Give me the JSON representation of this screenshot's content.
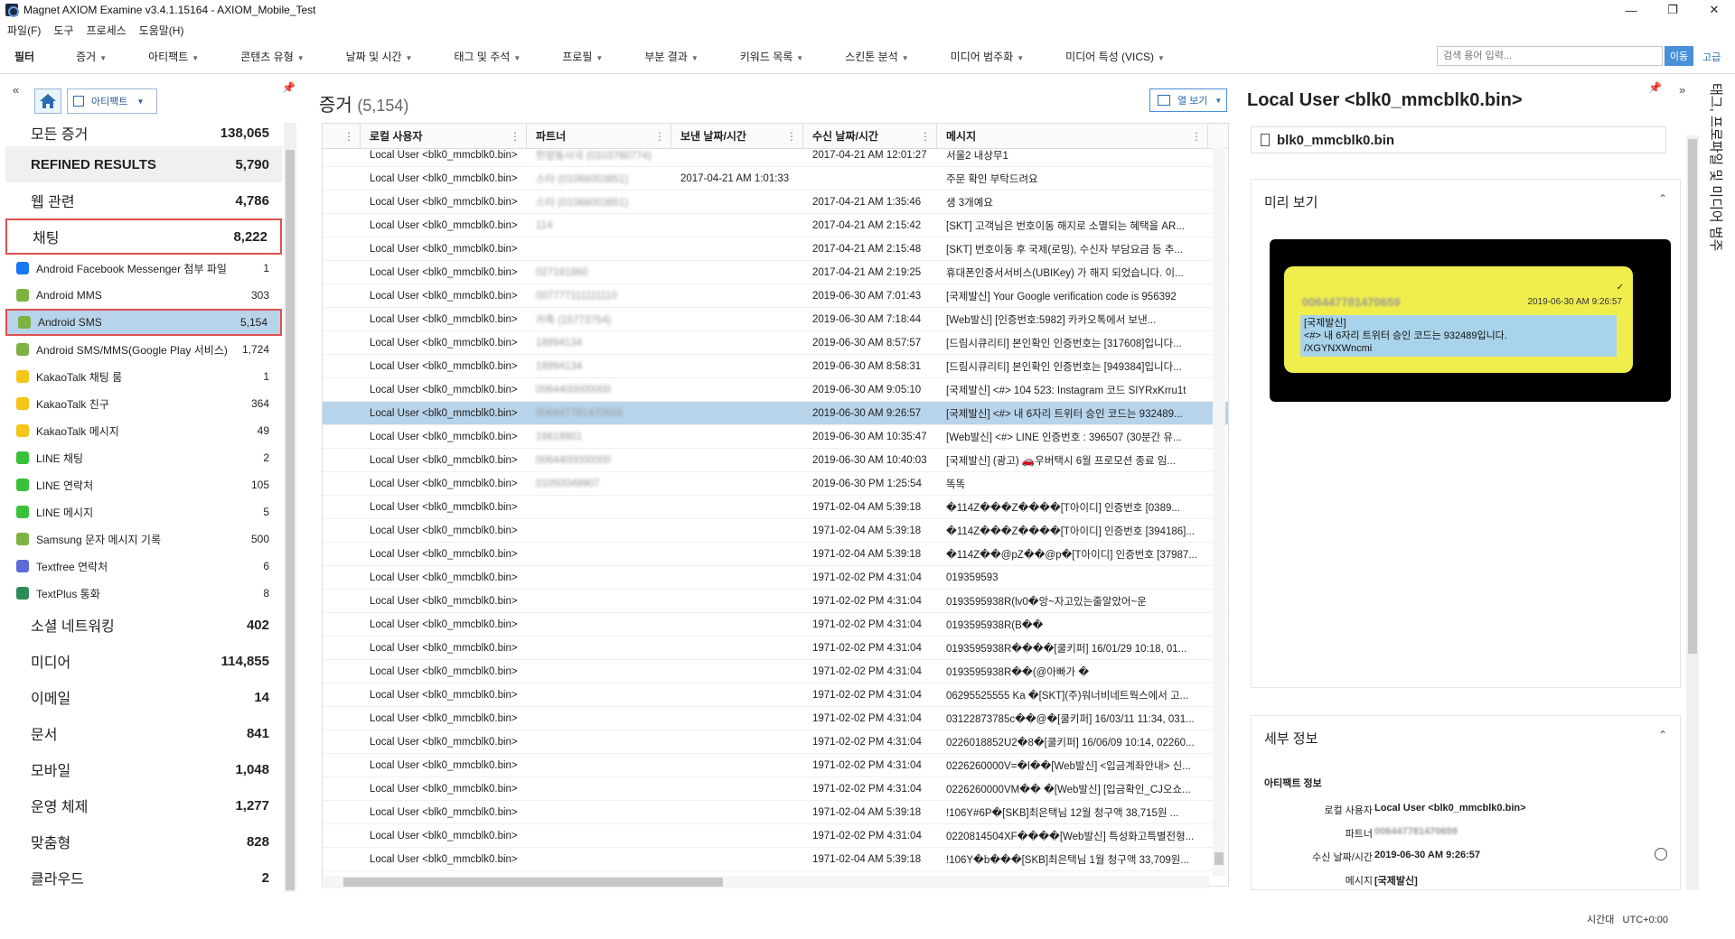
{
  "window": {
    "title": "Magnet AXIOM Examine v3.4.1.15164 - AXIOM_Mobile_Test"
  },
  "menu": [
    "파일(F)",
    "도구",
    "프로세스",
    "도움말(H)"
  ],
  "toolbar": {
    "filter": "필터",
    "items": [
      "증거",
      "아티팩트",
      "콘텐츠 유형",
      "날짜 및 시간",
      "태그 및 주석",
      "프로필",
      "부분 결과",
      "키워드 목록",
      "스킨톤 분석",
      "미디어 범주화",
      "미디어 특성 (VICS)"
    ],
    "search_placeholder": "검색 용어 입력...",
    "search_go": "이동",
    "advanced": "고급"
  },
  "left": {
    "artifact_btn": "아티팩트",
    "categories_top": [
      {
        "label": "모든 증거",
        "count": "138,065"
      },
      {
        "label": "REFINED RESULTS",
        "count": "5,790"
      },
      {
        "label": "웹 관련",
        "count": "4,786"
      },
      {
        "label": "채팅",
        "count": "8,222"
      }
    ],
    "chat_items": [
      {
        "label": "Android Facebook Messenger 첨부 파일",
        "count": "1",
        "color": "#1877f2"
      },
      {
        "label": "Android MMS",
        "count": "303",
        "color": "#7cb342"
      },
      {
        "label": "Android SMS",
        "count": "5,154",
        "color": "#7cb342"
      },
      {
        "label": "Android SMS/MMS(Google Play 서비스)",
        "count": "1,724",
        "color": "#7cb342"
      },
      {
        "label": "KakaoTalk 채팅 룸",
        "count": "1",
        "color": "#f5c518"
      },
      {
        "label": "KakaoTalk 친구",
        "count": "364",
        "color": "#f5c518"
      },
      {
        "label": "KakaoTalk 메시지",
        "count": "49",
        "color": "#f5c518"
      },
      {
        "label": "LINE 채팅",
        "count": "2",
        "color": "#3ac13a"
      },
      {
        "label": "LINE 연락처",
        "count": "105",
        "color": "#3ac13a"
      },
      {
        "label": "LINE 메시지",
        "count": "5",
        "color": "#3ac13a"
      },
      {
        "label": "Samsung 문자 메시지 기록",
        "count": "500",
        "color": "#7cb342"
      },
      {
        "label": "Textfree 연락처",
        "count": "6",
        "color": "#5b6bd8"
      },
      {
        "label": "TextPlus 통화",
        "count": "8",
        "color": "#2e8b57"
      }
    ],
    "categories_bottom": [
      {
        "label": "소셜 네트워킹",
        "count": "402"
      },
      {
        "label": "미디어",
        "count": "114,855"
      },
      {
        "label": "이메일",
        "count": "14"
      },
      {
        "label": "문서",
        "count": "841"
      },
      {
        "label": "모바일",
        "count": "1,048"
      },
      {
        "label": "운영 체제",
        "count": "1,277"
      },
      {
        "label": "맞춤형",
        "count": "828"
      },
      {
        "label": "클라우드",
        "count": "2"
      }
    ]
  },
  "middle": {
    "title": "증거",
    "count": "(5,154)",
    "column_view": "열 보기",
    "columns": [
      "로컬 사용자",
      "파트너",
      "보낸 날짜/시간",
      "수신 날짜/시간",
      "메시지"
    ],
    "rows": [
      [
        "Local User <blk0_mmcblk0.bin>",
        "한양동사국 (0103780774)",
        "",
        "2017-04-21 AM 12:01:27",
        "서울2 내상무1"
      ],
      [
        "Local User <blk0_mmcblk0.bin>",
        "스타 (01066003851)",
        "2017-04-21 AM 1:01:33",
        "",
        "주문 확인 부탁드려요"
      ],
      [
        "Local User <blk0_mmcblk0.bin>",
        "스타 (01066003851)",
        "",
        "2017-04-21 AM 1:35:46",
        "생 3개예요"
      ],
      [
        "Local User <blk0_mmcblk0.bin>",
        "114",
        "",
        "2017-04-21 AM 2:15:42",
        "[SKT] 고객님은 번호이동 해지로 소멸되는 혜택을 AR..."
      ],
      [
        "Local User <blk0_mmcblk0.bin>",
        "",
        "",
        "2017-04-21 AM 2:15:48",
        "[SKT] 번호이동 후 국제(로밍), 수신자 부담요금 등 추..."
      ],
      [
        "Local User <blk0_mmcblk0.bin>",
        "027181860",
        "",
        "2017-04-21 AM 2:19:25",
        "휴대폰인증서서비스(UBIKey) 가 해지 되었습니다. 이..."
      ],
      [
        "Local User <blk0_mmcblk0.bin>",
        "007777111111110",
        "",
        "2019-06-30 AM 7:01:43",
        "[국제발신] Your Google verification code is 956392"
      ],
      [
        "Local User <blk0_mmcblk0.bin>",
        "카톡 (15773754)",
        "",
        "2019-06-30 AM 7:18:44",
        "[Web발신] [인증번호:5982] 카카오톡에서 보낸..."
      ],
      [
        "Local User <blk0_mmcblk0.bin>",
        "18994134",
        "",
        "2019-06-30 AM 8:57:57",
        "[드림시큐리티] 본인확인 인증번호는 [317608]입니다..."
      ],
      [
        "Local User <blk0_mmcblk0.bin>",
        "18994134",
        "",
        "2019-06-30 AM 8:58:31",
        "[드림시큐리티] 본인확인 인증번호는 [949384]입니다..."
      ],
      [
        "Local User <blk0_mmcblk0.bin>",
        "0064400000000",
        "",
        "2019-06-30 AM 9:05:10",
        "[국제발신] <#> 104 523: Instagram 코드 SIYRxKrru1t"
      ],
      [
        "Local User <blk0_mmcblk0.bin>",
        "006447781470659",
        "",
        "2019-06-30 AM 9:26:57",
        "[국제발신] <#> 내 6자리 트위터 승인 코드는 932489..."
      ],
      [
        "Local User <blk0_mmcblk0.bin>",
        "16618901",
        "",
        "2019-06-30 AM 10:35:47",
        "[Web발신] <#> LINE 인증번호 : 396507 (30분간 유..."
      ],
      [
        "Local User <blk0_mmcblk0.bin>",
        "0064400000000",
        "",
        "2019-06-30 AM 10:40:03",
        "[국제발신] (광고) 🚗우버택시 6월 프로모션 종료 임..."
      ],
      [
        "Local User <blk0_mmcblk0.bin>",
        "01050049907",
        "",
        "2019-06-30 PM 1:25:54",
        "똑똑"
      ],
      [
        "Local User <blk0_mmcblk0.bin>",
        "",
        "",
        "1971-02-04 AM 5:39:18",
        "�114Z���Z����[T아이디] 인증번호 [0389..."
      ],
      [
        "Local User <blk0_mmcblk0.bin>",
        "",
        "",
        "1971-02-04 AM 5:39:18",
        "�114Z���Z����[T아이디] 인증번호 [394186]..."
      ],
      [
        "Local User <blk0_mmcblk0.bin>",
        "",
        "",
        "1971-02-04 AM 5:39:18",
        "�114Z��@pZ��@p�[T아이디] 인증번호 [37987..."
      ],
      [
        "Local User <blk0_mmcblk0.bin>",
        "",
        "",
        "1971-02-02 PM 4:31:04",
        "019359593"
      ],
      [
        "Local User <blk0_mmcblk0.bin>",
        "",
        "",
        "1971-02-02 PM 4:31:04",
        "0193595938R(lv0�앙~자고있는줄알았어~운"
      ],
      [
        "Local User <blk0_mmcblk0.bin>",
        "",
        "",
        "1971-02-02 PM 4:31:04",
        "0193595938R(B��"
      ],
      [
        "Local User <blk0_mmcblk0.bin>",
        "",
        "",
        "1971-02-02 PM 4:31:04",
        "0193595938R����[쿨키퍼] 16/01/29 10:18, 01..."
      ],
      [
        "Local User <blk0_mmcblk0.bin>",
        "",
        "",
        "1971-02-02 PM 4:31:04",
        "0193595938R��(@아빠가 �"
      ],
      [
        "Local User <blk0_mmcblk0.bin>",
        "",
        "",
        "1971-02-02 PM 4:31:04",
        "06295525555 Ka �[SKT](주)워너비네트웍스에서 고..."
      ],
      [
        "Local User <blk0_mmcblk0.bin>",
        "",
        "",
        "1971-02-02 PM 4:31:04",
        "03122873785c��@�[쿨키퍼] 16/03/11 11:34, 031..."
      ],
      [
        "Local User <blk0_mmcblk0.bin>",
        "",
        "",
        "1971-02-02 PM 4:31:04",
        "0226018852U2�8�[쿨키퍼] 16/06/09 10:14, 02260..."
      ],
      [
        "Local User <blk0_mmcblk0.bin>",
        "",
        "",
        "1971-02-02 PM 4:31:04",
        "0226260000V=�l��[Web발신] <입금계좌안내> 신..."
      ],
      [
        "Local User <blk0_mmcblk0.bin>",
        "",
        "",
        "1971-02-02 PM 4:31:04",
        "0226260000VM�� �[Web발신] [입금확인_CJ오쇼..."
      ],
      [
        "Local User <blk0_mmcblk0.bin>",
        "",
        "",
        "1971-02-04 AM 5:39:18",
        "!106Y#6P�[SKB]최은택님 12월 청구액 38,715원 ..."
      ],
      [
        "Local User <blk0_mmcblk0.bin>",
        "",
        "",
        "1971-02-02 PM 4:31:04",
        "0220814504XF����[Web발신] 특성화고특별전형..."
      ],
      [
        "Local User <blk0_mmcblk0.bin>",
        "",
        "",
        "1971-02-04 AM 5:39:18",
        "!106Y�b���[SKB]최은택님 1월 청구액 33,709원..."
      ]
    ]
  },
  "right": {
    "title": "Local User <blk0_mmcblk0.bin>",
    "file": "blk0_mmcblk0.bin",
    "preview_header": "미리 보기",
    "preview": {
      "number": "006447781470659",
      "time": "2019-06-30 AM 9:26:57",
      "msg_line1": "[국제발신]",
      "msg_line2": "<#> 내 6자리 트위터 승인 코드는 932489입니다.",
      "msg_line3": "/XGYNXWncmi"
    },
    "details_header": "세부 정보",
    "details_section": "아티팩트 정보",
    "details": [
      {
        "label": "로컬 사용자",
        "value": "Local User <blk0_mmcblk0.bin>"
      },
      {
        "label": "파트너",
        "value": "006447781470659"
      },
      {
        "label": "수신 날짜/시간",
        "value": "2019-06-30 AM 9:26:57"
      },
      {
        "label": "메시지",
        "value": "[국제발신]"
      }
    ],
    "side_tab": "태그, 프로파일 및 미디어 범주"
  },
  "status": {
    "tz_label": "시간대",
    "tz_value": "UTC+0:00"
  }
}
